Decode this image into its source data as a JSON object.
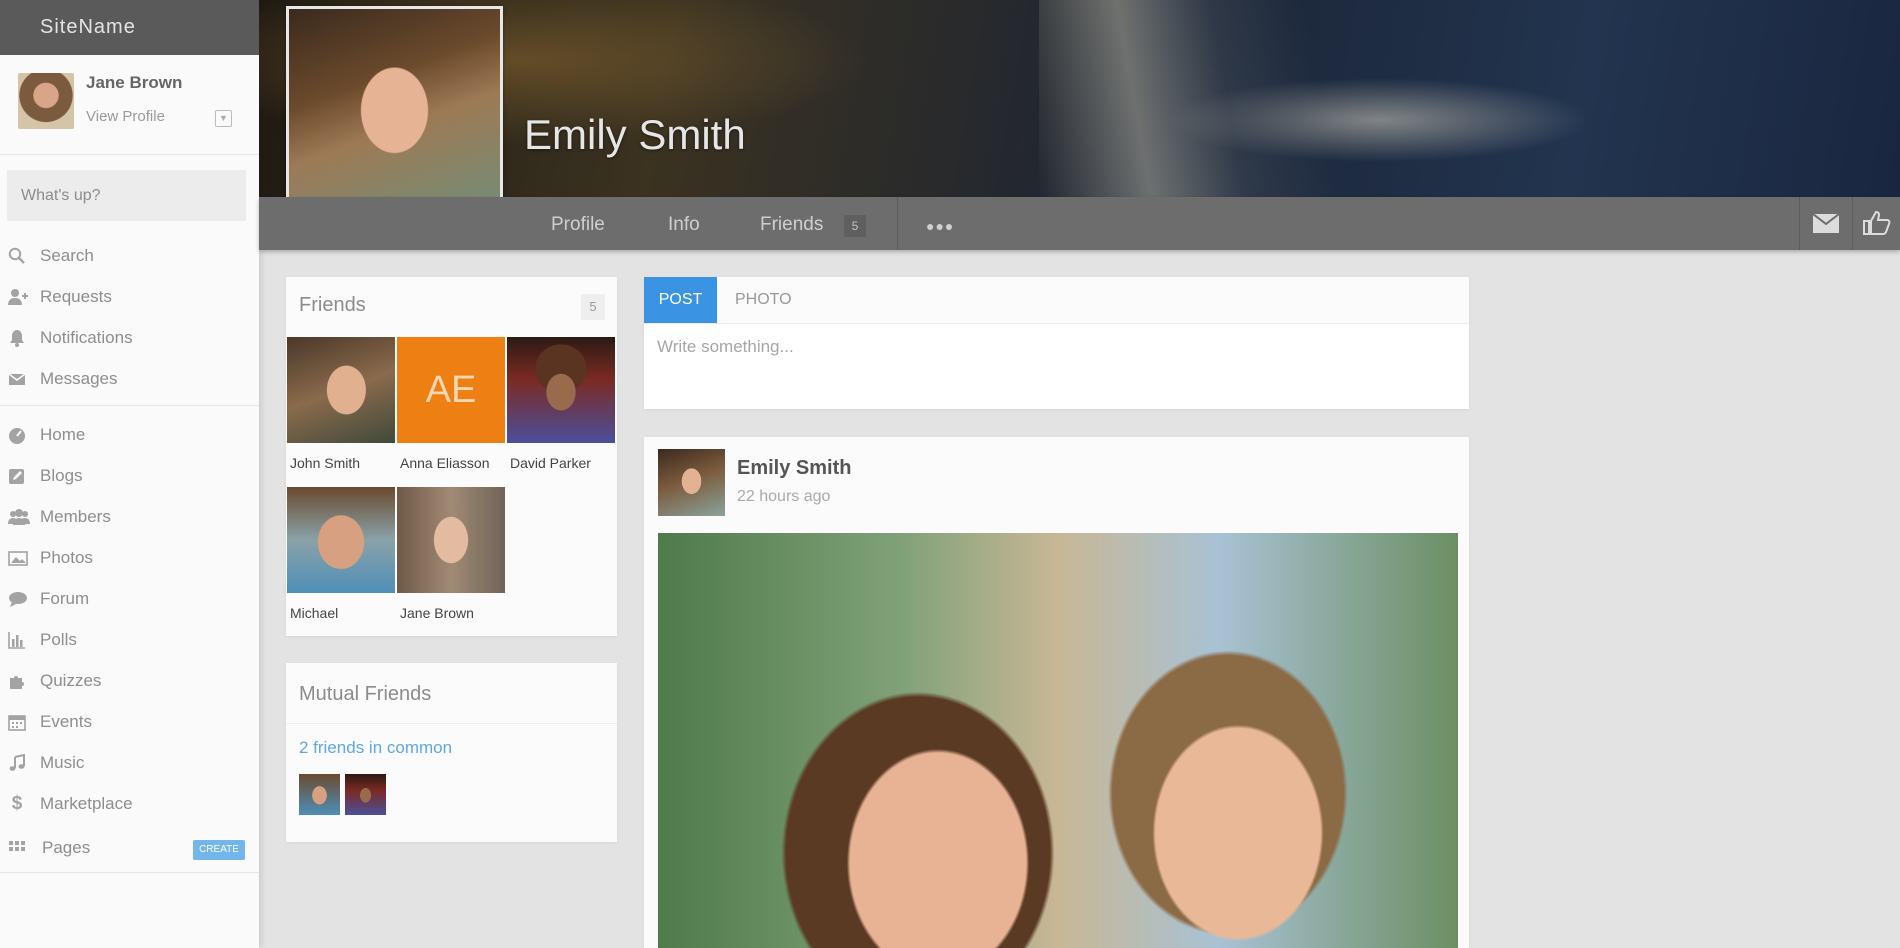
{
  "site": {
    "name": "SiteName"
  },
  "user": {
    "name": "Jane Brown",
    "view_profile": "View Profile"
  },
  "composer_sidebar": {
    "placeholder": "What's up?"
  },
  "nav_primary": [
    {
      "label": "Search",
      "icon": "search-icon"
    },
    {
      "label": "Requests",
      "icon": "add-user-icon"
    },
    {
      "label": "Notifications",
      "icon": "bell-icon"
    },
    {
      "label": "Messages",
      "icon": "envelope-icon"
    }
  ],
  "nav_secondary": [
    {
      "label": "Home",
      "icon": "dashboard-icon"
    },
    {
      "label": "Blogs",
      "icon": "edit-icon"
    },
    {
      "label": "Members",
      "icon": "users-icon"
    },
    {
      "label": "Photos",
      "icon": "image-icon"
    },
    {
      "label": "Forum",
      "icon": "chat-icon"
    },
    {
      "label": "Polls",
      "icon": "bar-chart-icon"
    },
    {
      "label": "Quizzes",
      "icon": "puzzle-icon"
    },
    {
      "label": "Events",
      "icon": "calendar-icon"
    },
    {
      "label": "Music",
      "icon": "music-icon"
    },
    {
      "label": "Marketplace",
      "icon": "dollar-icon"
    },
    {
      "label": "Pages",
      "icon": "grid-icon"
    }
  ],
  "create_badge": "CREATE",
  "profile": {
    "name": "Emily Smith",
    "tabs": {
      "profile": "Profile",
      "info": "Info",
      "friends": "Friends",
      "friends_count": "5"
    }
  },
  "friends_panel": {
    "title": "Friends",
    "count": "5",
    "friends": [
      {
        "name": "John Smith"
      },
      {
        "name": "Anna Eliasson",
        "initials": "AE"
      },
      {
        "name": "David Parker"
      },
      {
        "name": "Michael"
      },
      {
        "name": "Jane Brown"
      }
    ]
  },
  "mutual_panel": {
    "title": "Mutual Friends",
    "link": "2 friends in common"
  },
  "composer": {
    "tab_post": "POST",
    "tab_photo": "PHOTO",
    "placeholder": "Write something..."
  },
  "post": {
    "author": "Emily Smith",
    "time": "22 hours ago"
  },
  "colors": {
    "accent": "#3a94e3",
    "link": "#5fa7e3",
    "initials_tile": "#ee7f12",
    "tabbar": "#6d6d6d"
  }
}
